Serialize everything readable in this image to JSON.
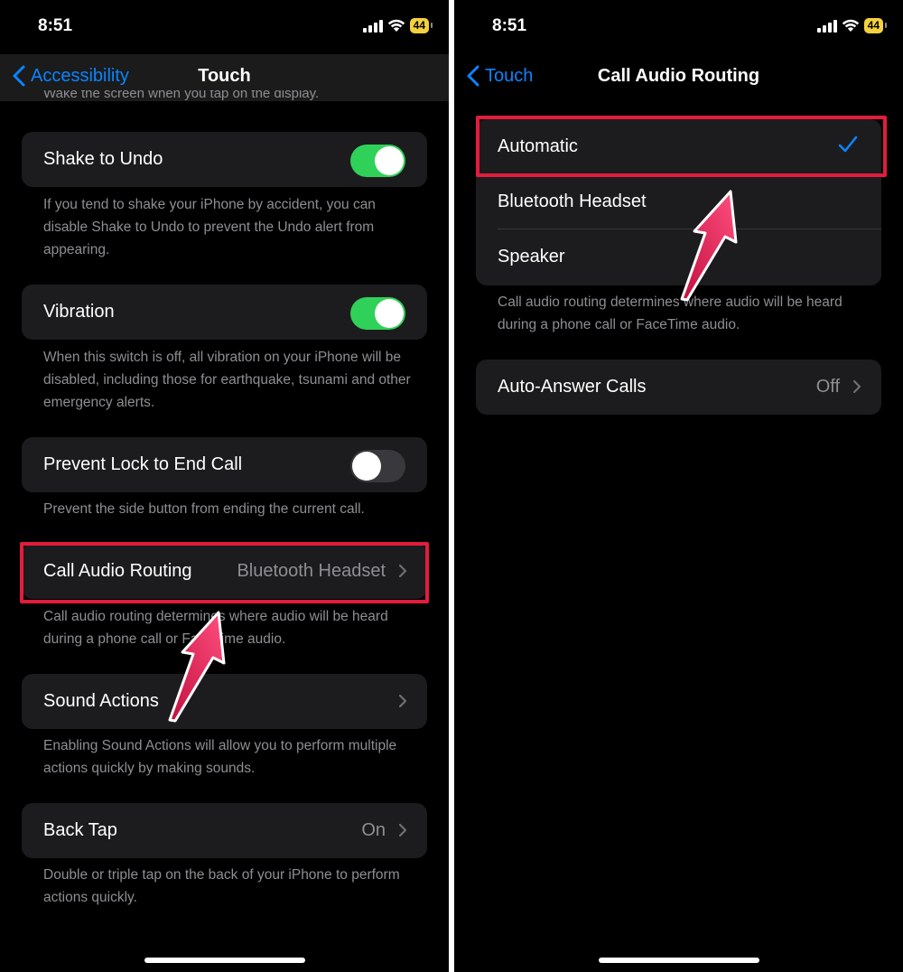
{
  "left": {
    "status": {
      "time": "8:51",
      "battery": "44"
    },
    "nav": {
      "back_label": "Accessibility",
      "title": "Touch"
    },
    "cutoff_text": "Wake the screen when you tap on the display.",
    "shake_to_undo": {
      "label": "Shake to Undo",
      "on": true,
      "footer": "If you tend to shake your iPhone by accident, you can disable Shake to Undo to prevent the Undo alert from appearing."
    },
    "vibration": {
      "label": "Vibration",
      "on": true,
      "footer": "When this switch is off, all vibration on your iPhone will be disabled, including those for earthquake, tsunami and other emergency alerts."
    },
    "prevent_lock": {
      "label": "Prevent Lock to End Call",
      "on": false,
      "footer": "Prevent the side button from ending the current call."
    },
    "call_audio_routing": {
      "label": "Call Audio Routing",
      "value": "Bluetooth Headset",
      "footer": "Call audio routing determines where audio will be heard during a phone call or FaceTime audio."
    },
    "sound_actions": {
      "label": "Sound Actions",
      "footer": "Enabling Sound Actions will allow you to perform multiple actions quickly by making sounds."
    },
    "back_tap": {
      "label": "Back Tap",
      "value": "On",
      "footer": "Double or triple tap on the back of your iPhone to perform actions quickly."
    }
  },
  "right": {
    "status": {
      "time": "8:51",
      "battery": "44"
    },
    "nav": {
      "back_label": "Touch",
      "title": "Call Audio Routing"
    },
    "options": [
      {
        "label": "Automatic",
        "selected": true
      },
      {
        "label": "Bluetooth Headset",
        "selected": false
      },
      {
        "label": "Speaker",
        "selected": false
      }
    ],
    "options_footer": "Call audio routing determines where audio will be heard during a phone call or FaceTime audio.",
    "auto_answer": {
      "label": "Auto-Answer Calls",
      "value": "Off"
    }
  },
  "colors": {
    "accent": "#0a84ff",
    "toggle_on": "#30d158",
    "highlight": "#e31c3d",
    "arrow": "#e8235a"
  },
  "icons": [
    "signal-icon",
    "wifi-icon",
    "battery-icon",
    "back-chevron-icon",
    "chevron-right-icon",
    "checkmark-icon",
    "pointer-arrow-icon"
  ]
}
